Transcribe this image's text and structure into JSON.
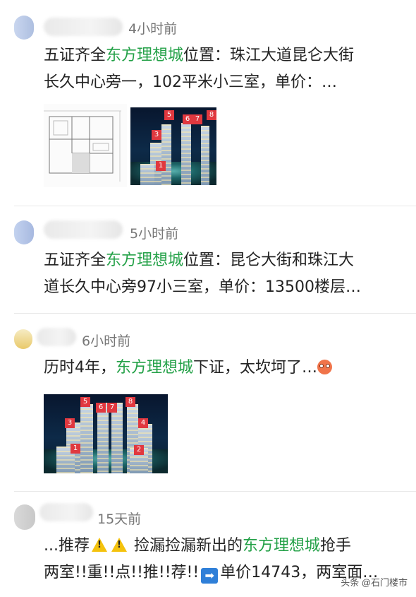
{
  "posts": [
    {
      "time": "4小时前",
      "text_before": "五证齐全",
      "keyword": "东方理想城",
      "text_after": "位置：珠江大道昆仑大街",
      "line2": "长久中心旁一，102平米小三室，单价：…",
      "image_labels": [
        "5",
        "6",
        "7",
        "8",
        "3",
        "1"
      ]
    },
    {
      "time": "5小时前",
      "text_before": "五证齐全",
      "keyword": "东方理想城",
      "text_after": "位置：昆仑大街和珠江大",
      "line2": "道长久中心旁97小三室，单价：13500楼层…"
    },
    {
      "time": "6小时前",
      "text_before": "历时4年，",
      "keyword": "东方理想城",
      "text_after": "下证，太坎坷了…",
      "emoji": "scared-face-icon",
      "image_labels": [
        "5",
        "6",
        "7",
        "8",
        "3",
        "4",
        "1",
        "2"
      ]
    },
    {
      "time": "15天前",
      "text_before": "...推荐",
      "text_mid": "捡漏捡漏新出的",
      "keyword": "东方理想城",
      "text_after": "抢手",
      "line2_a": "两室!!重!!点!!推!!荐!!",
      "line2_b": "单价14743，两室面…"
    }
  ],
  "watermark": "头条 @石门楼市",
  "colors": {
    "keyword": "#24a148",
    "time": "#777777",
    "divider": "#e8e8e8"
  }
}
